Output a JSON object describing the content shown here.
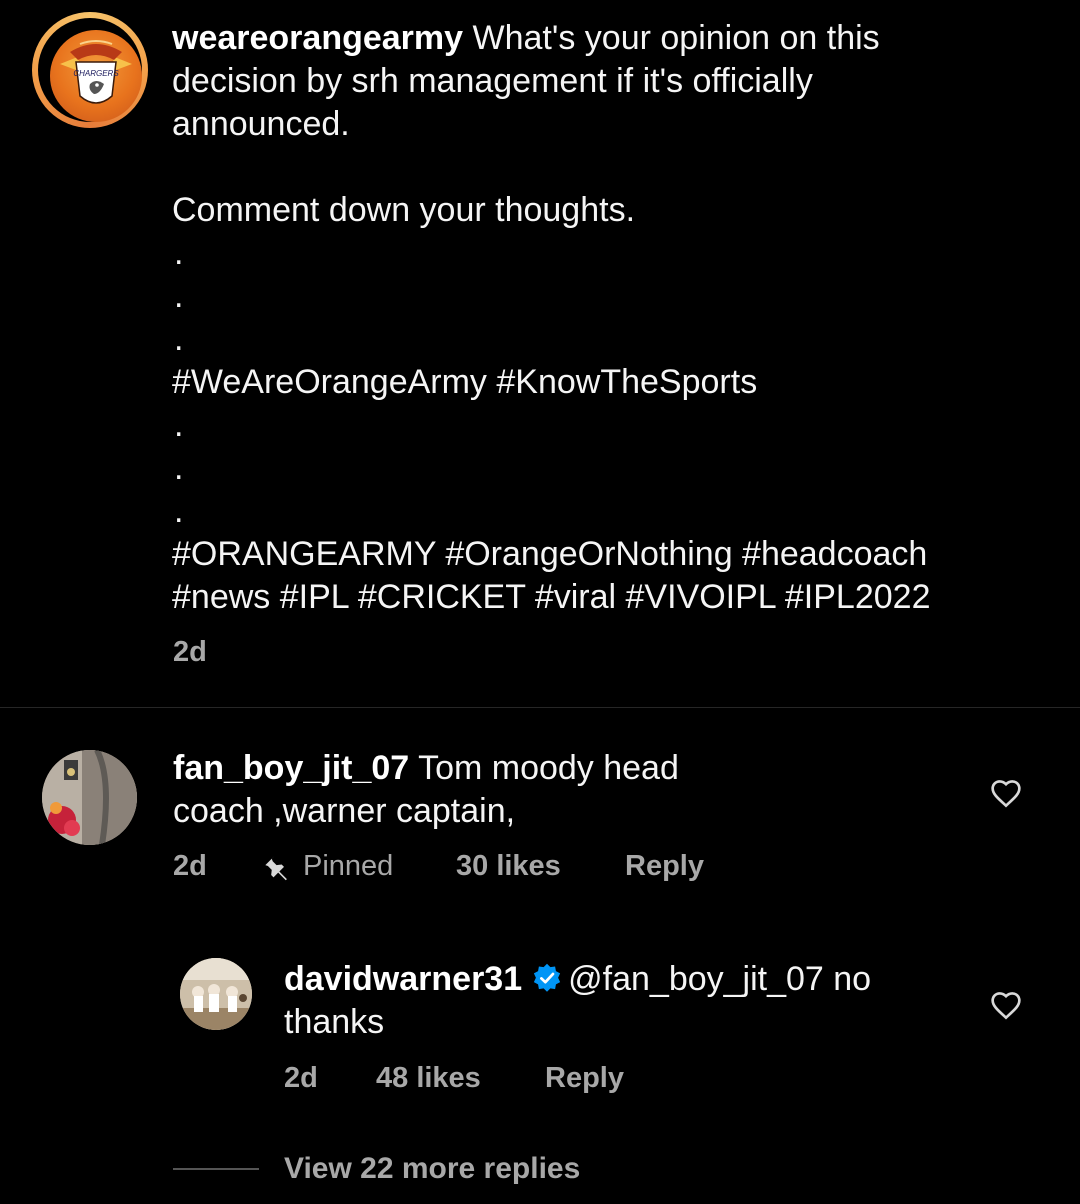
{
  "post": {
    "username": "weareorangearmy",
    "avatar_icon": "sunrisers-chargers-logo",
    "avatar_logo_text": "CHARGERS",
    "caption_line1": "What's your opinion on this",
    "caption_line2": "decision by srh management if it's officially",
    "caption_line3": "announced.",
    "caption_line4": "Comment down your thoughts.",
    "dot": ".",
    "hashtags_line1": "#WeAreOrangeArmy #KnowTheSports",
    "hashtags_line2": "#ORANGEARMY #OrangeOrNothing #headcoach",
    "hashtags_line3": "#news #IPL #CRICKET #viral #VIVOIPL #IPL2022",
    "time": "2d"
  },
  "comments": [
    {
      "username": "fan_boy_jit_07",
      "text_line1": "Tom moody head",
      "text_line2": "coach ,warner captain,",
      "time": "2d",
      "pinned_label": "Pinned",
      "likes": "30 likes",
      "reply_label": "Reply",
      "like_icon": "heart-outline-icon",
      "pin_icon": "pin-icon"
    }
  ],
  "reply": {
    "username": "davidwarner31",
    "verified_icon": "verified-badge-icon",
    "text_line1": "@fan_boy_jit_07 no",
    "text_line2": "thanks",
    "time": "2d",
    "likes": "48 likes",
    "reply_label": "Reply",
    "like_icon": "heart-outline-icon"
  },
  "view_more_replies": "View 22 more replies",
  "colors": {
    "background": "#000000",
    "primary_text": "#f5f5f5",
    "secondary_text": "#a8a8a8",
    "verified_blue": "#0095f6",
    "ring_orange": "#f3a04a"
  }
}
